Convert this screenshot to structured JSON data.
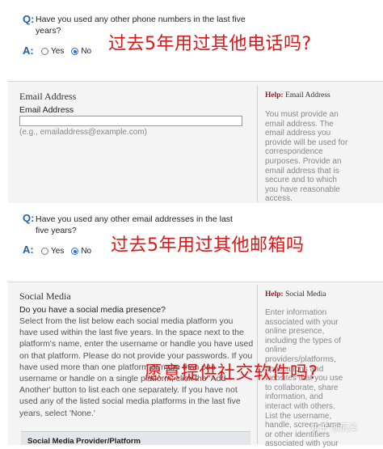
{
  "q_phone": {
    "marker": "Q:",
    "text": "Have you used any other phone numbers in the last five years?",
    "answer_marker": "A:",
    "options": {
      "yes": "Yes",
      "no": "No"
    },
    "selected": "No",
    "overlay_cn": "过去5年用过其他电话吗?"
  },
  "email_section": {
    "title": "Email Address",
    "field_label": "Email Address",
    "value": "",
    "hint": "(e.g., emailaddress@example.com)",
    "help_title_prefix": "Help:",
    "help_title_name": "Email Address",
    "help_text": "You must provide an email address. The email address you provide will be used for correspondence purposes. Provide an email address that is secure and to which you have reasonable access."
  },
  "q_email": {
    "marker": "Q:",
    "text": "Have you used any other email addresses in the last five years?",
    "answer_marker": "A:",
    "options": {
      "yes": "Yes",
      "no": "No"
    },
    "selected": "No",
    "overlay_cn": "过去5年用过其他邮箱吗"
  },
  "social_section": {
    "title": "Social Media",
    "question": "Do you have a social media presence?",
    "body": "Select from the list below each social media platform you have used within the last five years. In the space next to the platform's name, enter the username or handle you have used on that platform. Please do not provide your passwords. If you have used more than one platform or more than one username or handle on a single platform, click the 'Add Another' button to list each one separately. If you have not used any of the listed social media platforms in the last five years, select 'None.'",
    "overlay_cn": "愿意提供社交软件吗?",
    "help_title_prefix": "Help:",
    "help_title_name": "Social Media",
    "help_text": "Enter information associated with your online presence, including the types of online providers/platforms, applications and websites that you use to collaborate, share information, and interact with others. List the username, handle, screen-name, or other identifiers associated with your",
    "subheader": "Social Media Provider/Platform"
  },
  "watermark": "知乎 @辰奚"
}
